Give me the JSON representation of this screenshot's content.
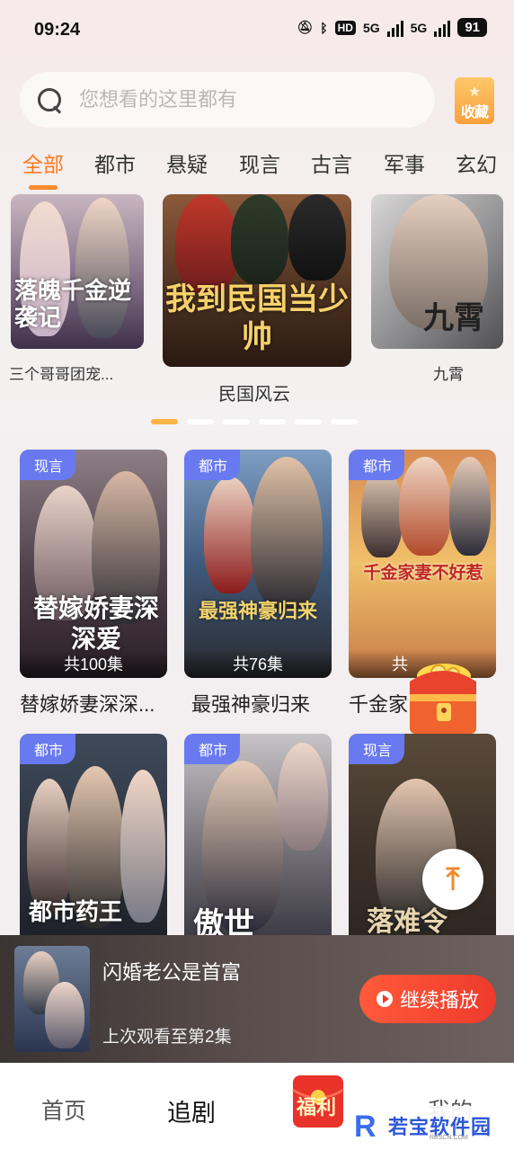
{
  "status_bar": {
    "time": "09:24",
    "network_label": "5G",
    "hd_label": "HD",
    "battery": "91"
  },
  "search": {
    "placeholder": "您想看的这里都有"
  },
  "favorite": {
    "label": "收藏"
  },
  "tabs": [
    {
      "label": "全部",
      "active": true
    },
    {
      "label": "都市",
      "active": false
    },
    {
      "label": "悬疑",
      "active": false
    },
    {
      "label": "现言",
      "active": false
    },
    {
      "label": "古言",
      "active": false
    },
    {
      "label": "军事",
      "active": false
    },
    {
      "label": "玄幻",
      "active": false
    }
  ],
  "carousel": {
    "items": [
      {
        "title": "三个哥哥团宠...",
        "poster_text": "落魄千金逆袭记"
      },
      {
        "title": "民国风云",
        "poster_text": "我到民国当少帅"
      },
      {
        "title": "九霄",
        "poster_text": "九霄"
      }
    ],
    "page_count": 6,
    "active_page": 0
  },
  "dramas": [
    {
      "genre": "现言",
      "episodes": "共100集",
      "title": "替嫁娇妻深深...",
      "poster_text": "替嫁娇妻深深爱"
    },
    {
      "genre": "都市",
      "episodes": "共76集",
      "title": "最强神豪归来",
      "poster_text": "最强神豪归来"
    },
    {
      "genre": "都市",
      "episodes": "共",
      "title": "千金家...",
      "poster_text": "千金家妻不好惹"
    },
    {
      "genre": "都市",
      "episodes": "",
      "title": "",
      "poster_text": "都市药王"
    },
    {
      "genre": "都市",
      "episodes": "",
      "title": "",
      "poster_text": "傲世"
    },
    {
      "genre": "现言",
      "episodes": "",
      "title": "",
      "poster_text": "落难令"
    }
  ],
  "continue_watching": {
    "title": "闪婚老公是首富",
    "progress_text": "上次观看至第2集",
    "button_label": "继续播放"
  },
  "bottom_nav": [
    {
      "label": "首页",
      "active": false
    },
    {
      "label": "追剧",
      "active": true
    },
    {
      "label": "福利",
      "active": false
    },
    {
      "label": "我的",
      "active": false
    }
  ],
  "watermark": {
    "logo_letter": "R",
    "text": "若宝软件园",
    "url": "RBSCN.COM"
  },
  "colors": {
    "accent": "#ff7a1a",
    "badge": "#6979f0",
    "play_button": "#ee3a2c"
  }
}
